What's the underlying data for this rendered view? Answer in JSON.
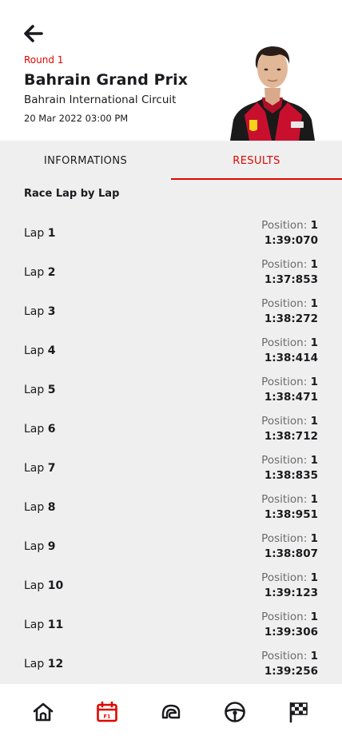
{
  "header": {
    "round": "Round 1",
    "race_name": "Bahrain Grand Prix",
    "circuit": "Bahrain International Circuit",
    "datetime": "20 Mar 2022 03:00 PM"
  },
  "tabs": [
    {
      "label": "INFORMATIONS",
      "active": false
    },
    {
      "label": "RESULTS",
      "active": true
    }
  ],
  "section": {
    "title": "Race Lap by Lap"
  },
  "laps": [
    {
      "prefix": "Lap",
      "num": "1",
      "pos_label": "Position:",
      "pos": "1",
      "time": "1:39:070"
    },
    {
      "prefix": "Lap",
      "num": "2",
      "pos_label": "Position:",
      "pos": "1",
      "time": "1:37:853"
    },
    {
      "prefix": "Lap",
      "num": "3",
      "pos_label": "Position:",
      "pos": "1",
      "time": "1:38:272"
    },
    {
      "prefix": "Lap",
      "num": "4",
      "pos_label": "Position:",
      "pos": "1",
      "time": "1:38:414"
    },
    {
      "prefix": "Lap",
      "num": "5",
      "pos_label": "Position:",
      "pos": "1",
      "time": "1:38:471"
    },
    {
      "prefix": "Lap",
      "num": "6",
      "pos_label": "Position:",
      "pos": "1",
      "time": "1:38:712"
    },
    {
      "prefix": "Lap",
      "num": "7",
      "pos_label": "Position:",
      "pos": "1",
      "time": "1:38:835"
    },
    {
      "prefix": "Lap",
      "num": "8",
      "pos_label": "Position:",
      "pos": "1",
      "time": "1:38:951"
    },
    {
      "prefix": "Lap",
      "num": "9",
      "pos_label": "Position:",
      "pos": "1",
      "time": "1:38:807"
    },
    {
      "prefix": "Lap",
      "num": "10",
      "pos_label": "Position:",
      "pos": "1",
      "time": "1:39:123"
    },
    {
      "prefix": "Lap",
      "num": "11",
      "pos_label": "Position:",
      "pos": "1",
      "time": "1:39:306"
    },
    {
      "prefix": "Lap",
      "num": "12",
      "pos_label": "Position:",
      "pos": "1",
      "time": "1:39:256"
    }
  ],
  "bottom_nav": [
    {
      "icon": "home-icon",
      "active": false
    },
    {
      "icon": "calendar-f1-icon",
      "active": true,
      "badge": "F1"
    },
    {
      "icon": "circuit-icon",
      "active": false
    },
    {
      "icon": "steering-wheel-icon",
      "active": false
    },
    {
      "icon": "checkered-flag-icon",
      "active": false
    }
  ],
  "colors": {
    "accent": "#e10600",
    "text": "#1b1b1f",
    "muted": "#6b6b6b",
    "content_bg": "#efefef"
  }
}
